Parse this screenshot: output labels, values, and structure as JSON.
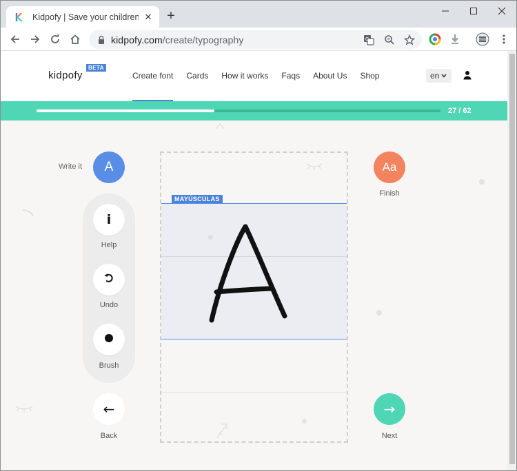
{
  "browser": {
    "tab_title": "Kidpofy | Save your children's d",
    "tab_close": "✕",
    "new_tab": "+",
    "url_host": "kidpofy.com",
    "url_path": "/create/typography"
  },
  "site": {
    "logo": "kidpofy",
    "beta": "BETA",
    "nav": [
      "Create font",
      "Cards",
      "How it works",
      "Faqs",
      "About Us",
      "Shop"
    ],
    "active_nav": "Create font",
    "language": "en"
  },
  "progress": {
    "label": "27 / 62",
    "current": 27,
    "total": 62,
    "fill_fraction": 0.44
  },
  "tools": {
    "write_label": "Write it",
    "write_letter": "A",
    "help_label": "Help",
    "help_glyph": "i",
    "undo_label": "Undo",
    "brush_label": "Brush",
    "back_label": "Back",
    "back_glyph": "←"
  },
  "right": {
    "finish_label": "Finish",
    "finish_glyph": "Aa",
    "next_label": "Next",
    "next_glyph": "→"
  },
  "canvas": {
    "case_tag": "MAYÚSCULAS"
  },
  "colors": {
    "accent_blue": "#5a8ee6",
    "accent_green": "#4fd7b5",
    "accent_orange": "#f4845f"
  }
}
